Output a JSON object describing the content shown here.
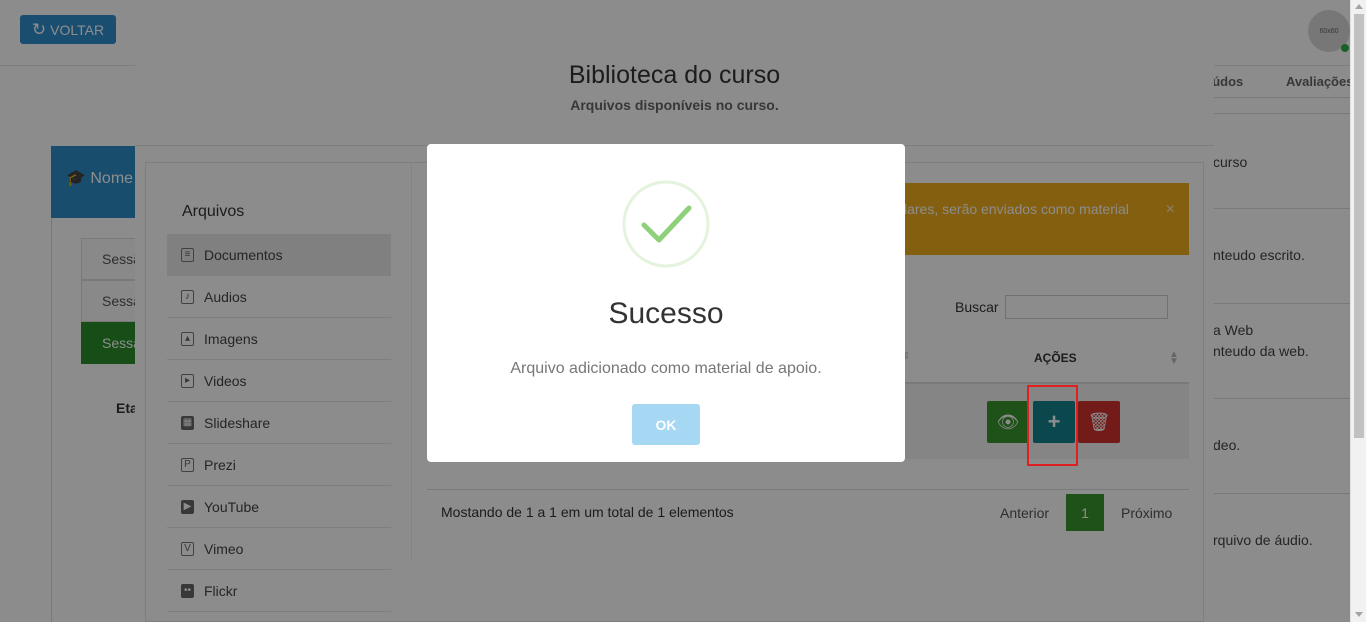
{
  "header": {
    "back_label": "VOLTAR",
    "avatar_label": "60x60"
  },
  "background": {
    "tabs": [
      "eúdos",
      "Avaliações"
    ],
    "list_items": [
      "curso",
      "nteudo escrito.",
      "a Web\nnteudo da web.",
      "deo.",
      "rquivo de áudio."
    ],
    "card_title": "Nome",
    "sessions": [
      "Sessã",
      "Sessã",
      "Sessã"
    ],
    "eta_label": "Eta"
  },
  "library": {
    "title": "Biblioteca do curso",
    "subtitle": "Arquivos disponíveis no curso.",
    "files_heading": "Arquivos",
    "menu": [
      {
        "label": "Documentos",
        "icon": "document-icon",
        "glyph": "≡"
      },
      {
        "label": "Audios",
        "icon": "audio-file-icon",
        "glyph": "♪"
      },
      {
        "label": "Imagens",
        "icon": "image-file-icon",
        "glyph": "▴"
      },
      {
        "label": "Videos",
        "icon": "video-file-icon",
        "glyph": "▸"
      },
      {
        "label": "Slideshare",
        "icon": "slideshare-icon",
        "glyph": "▦"
      },
      {
        "label": "Prezi",
        "icon": "prezi-icon",
        "glyph": "P"
      },
      {
        "label": "YouTube",
        "icon": "youtube-icon",
        "glyph": "▶"
      },
      {
        "label": "Vimeo",
        "icon": "vimeo-icon",
        "glyph": "V"
      },
      {
        "label": "Flickr",
        "icon": "flickr-icon",
        "glyph": "••"
      }
    ],
    "alert_text": "lares, serão enviados como material",
    "alert_close": "×",
    "search_label": "Buscar",
    "search_value": "",
    "column_actions": "AÇÕES",
    "footer_info": "Mostando de 1 a 1 em um total de 1 elementos",
    "pagination": {
      "prev": "Anterior",
      "current": "1",
      "next": "Próximo"
    },
    "row_actions": {
      "view": "👁",
      "add": "+",
      "delete": "🗑"
    }
  },
  "dialog": {
    "title": "Sucesso",
    "message": "Arquivo adicionado como material de apoio.",
    "ok_label": "OK",
    "icon": "success-check-icon"
  },
  "colors": {
    "success_green": "#8fd07a",
    "ok_button": "#a6d8f3",
    "primary_blue": "#2f8fce",
    "alert_orange": "#f0ad1e"
  }
}
